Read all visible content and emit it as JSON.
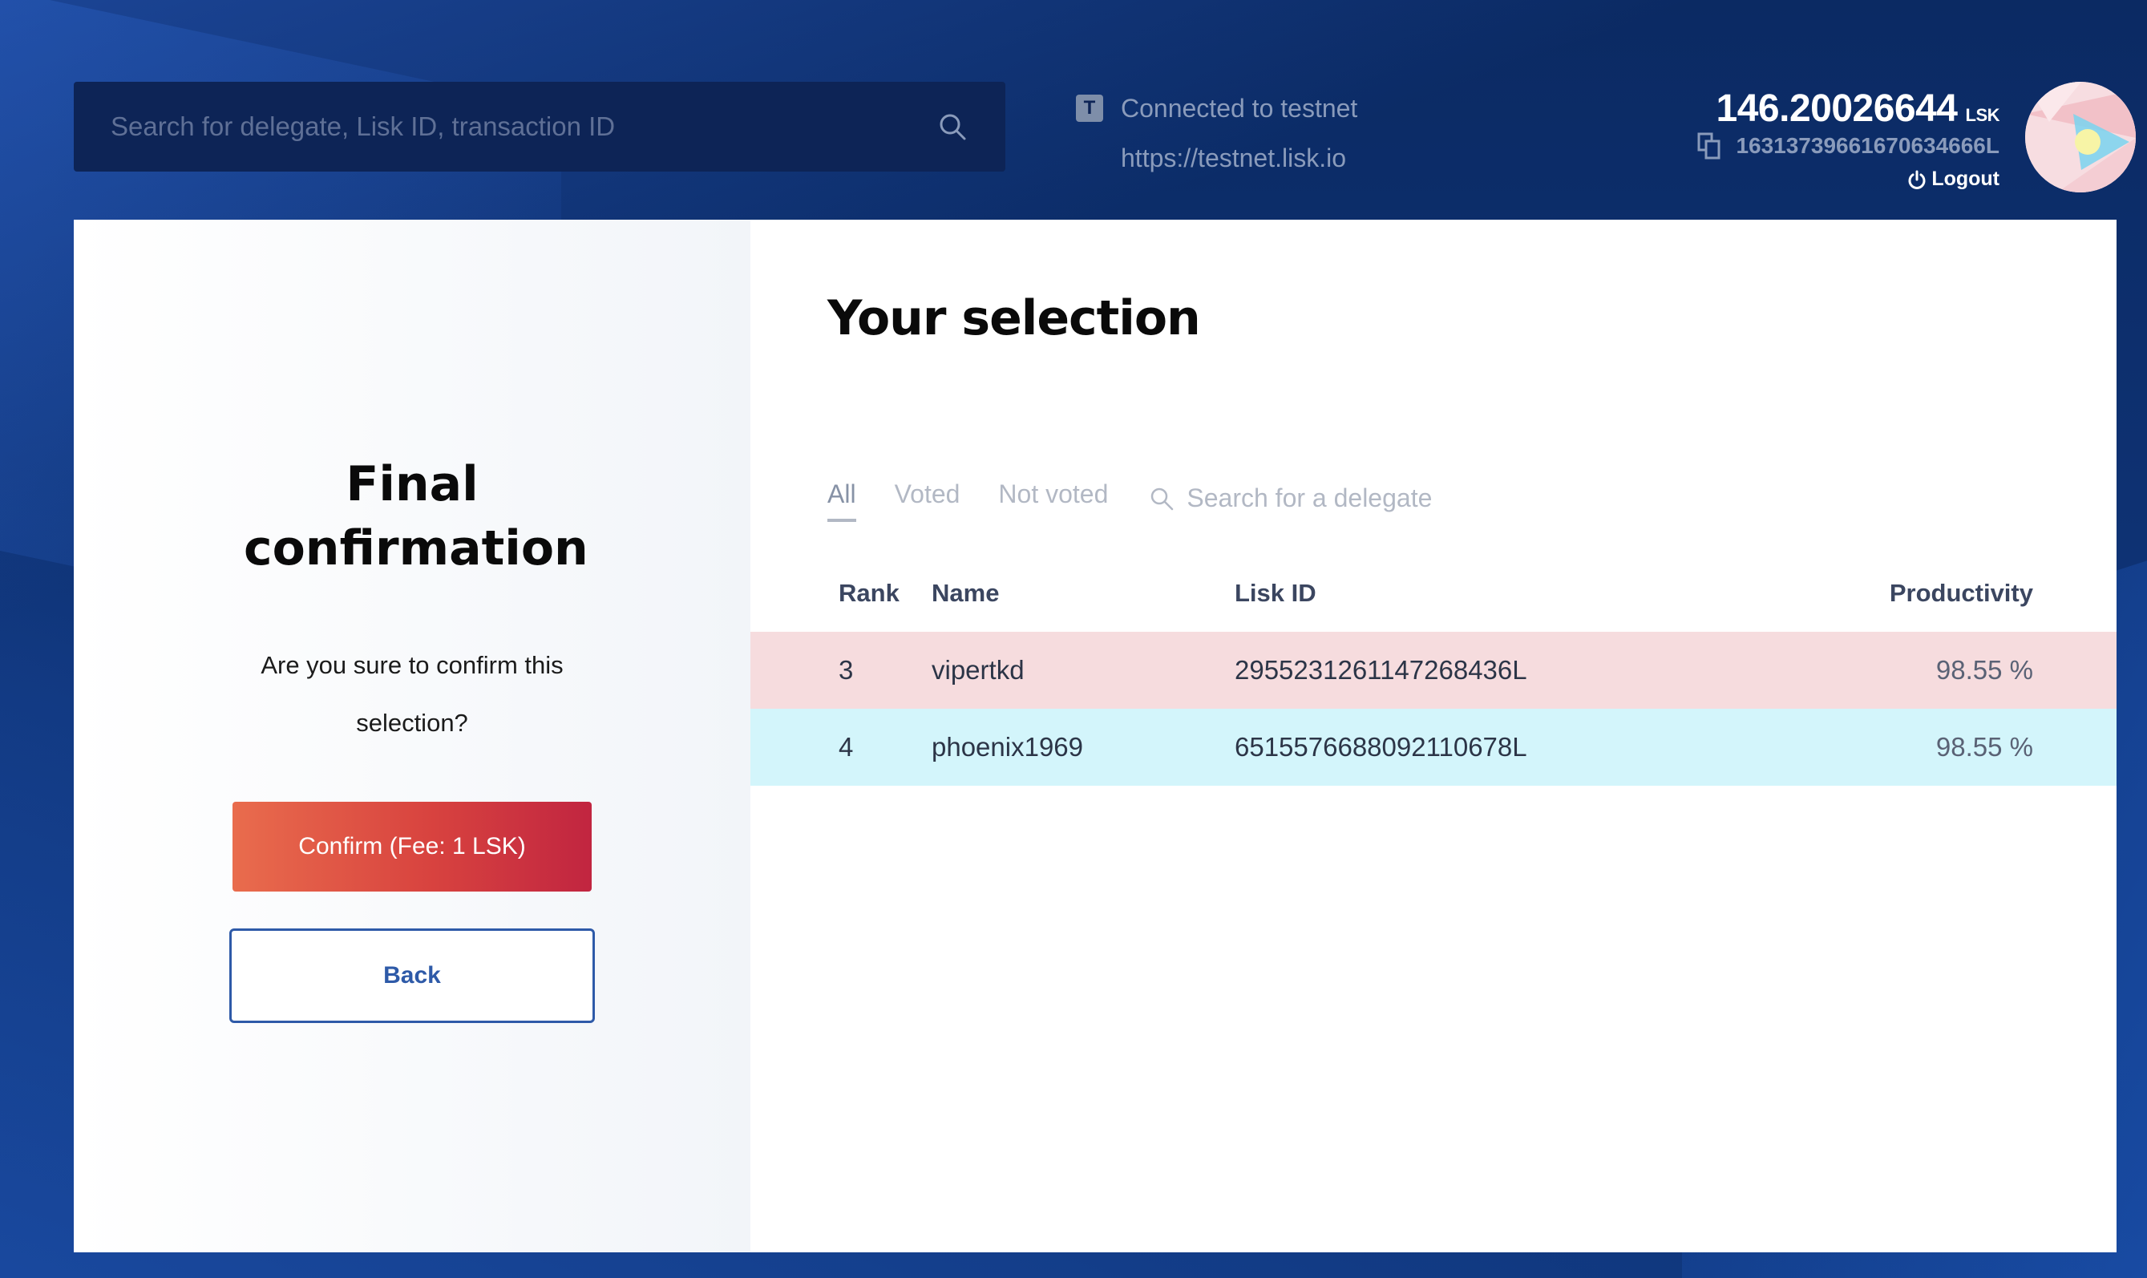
{
  "header": {
    "search_placeholder": "Search for delegate, Lisk ID, transaction ID",
    "network": {
      "badge": "T",
      "status": "Connected to testnet",
      "url": "https://testnet.lisk.io"
    },
    "account": {
      "balance": "146.20026644",
      "unit": "LSK",
      "address": "16313739661670634666L",
      "logout_label": "Logout"
    }
  },
  "confirmation": {
    "title": "Final confirmation",
    "question": "Are you sure to confirm this selection?",
    "confirm_label": "Confirm (Fee: 1 LSK)",
    "back_label": "Back"
  },
  "selection": {
    "title": "Your selection",
    "filters": [
      "All",
      "Voted",
      "Not voted"
    ],
    "active_filter": "All",
    "search_placeholder": "Search for a delegate",
    "columns": [
      "Rank",
      "Name",
      "Lisk ID",
      "Productivity"
    ],
    "rows": [
      {
        "rank": "3",
        "name": "vipertkd",
        "lisk_id": "2955231261147268436L",
        "productivity": "98.55 %",
        "state": "unvote"
      },
      {
        "rank": "4",
        "name": "phoenix1969",
        "lisk_id": "6515576688092110678L",
        "productivity": "98.55 %",
        "state": "vote"
      }
    ]
  },
  "colors": {
    "background": "#0c2c6b",
    "confirm_gradient_start": "#e96c4d",
    "confirm_gradient_end": "#c12540",
    "unvote_row": "#f6dcde",
    "vote_row": "#d3f5fb",
    "back_border": "#2e5aa8"
  }
}
